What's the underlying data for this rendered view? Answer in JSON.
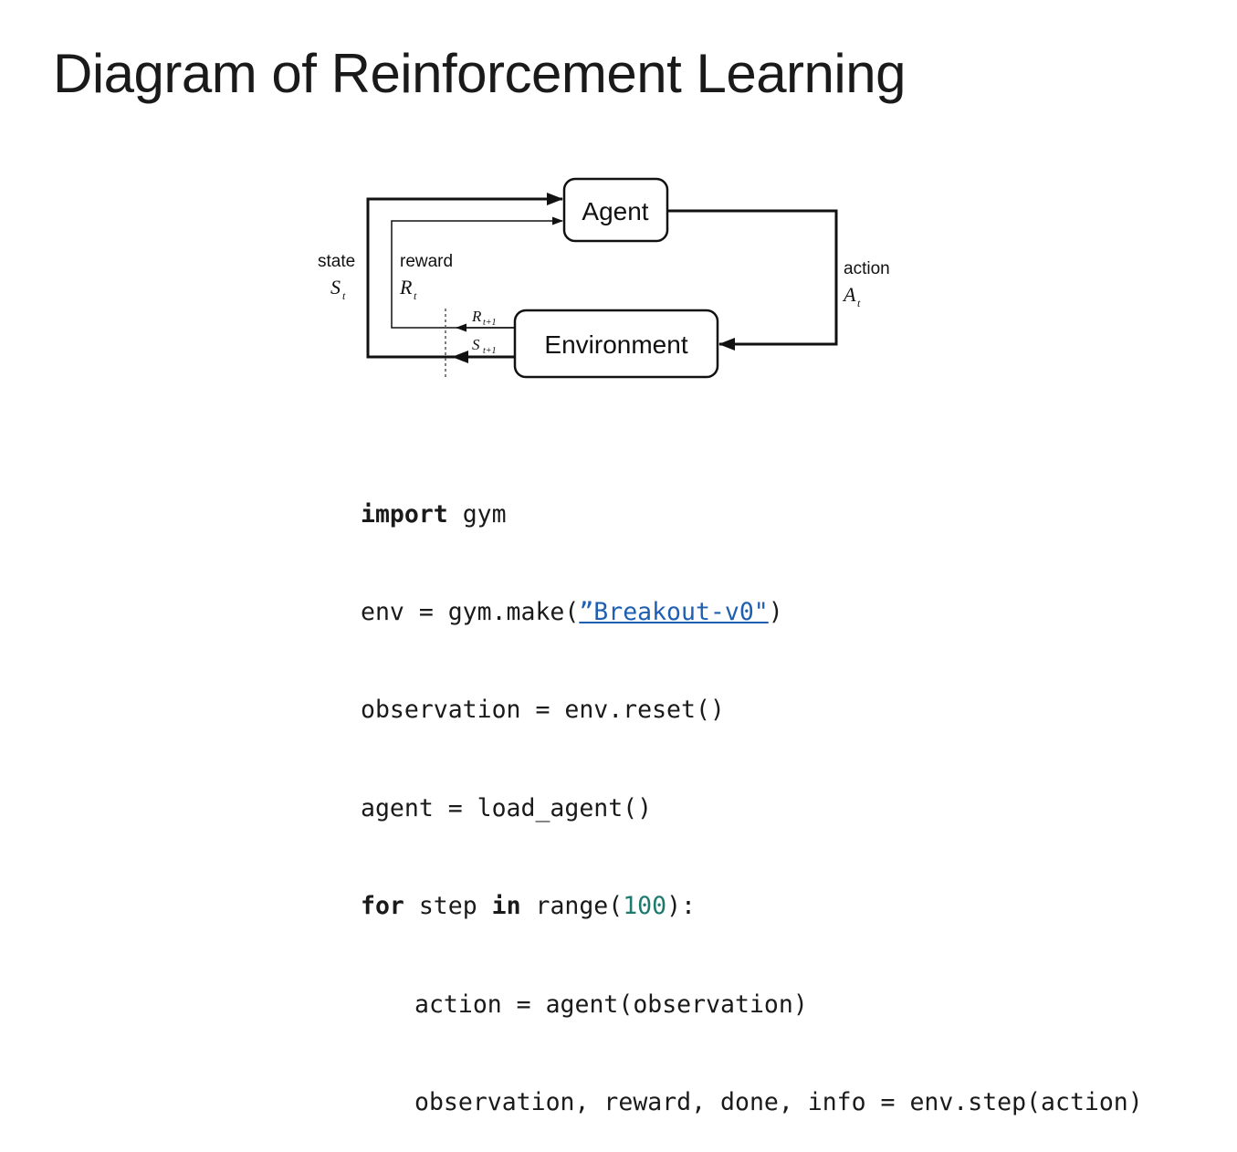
{
  "title": "Diagram of Reinforcement Learning",
  "diagram": {
    "agent_label": "Agent",
    "environment_label": "Environment",
    "state_label": "state",
    "state_symbol": "S",
    "state_symbol_sub": "t",
    "reward_label": "reward",
    "reward_symbol": "R",
    "reward_symbol_sub": "t",
    "action_label": "action",
    "action_symbol": "A",
    "action_symbol_sub": "t",
    "next_reward_symbol": "R",
    "next_reward_sub": "t+1",
    "next_state_symbol": "S",
    "next_state_sub": "t+1"
  },
  "code": {
    "line1_kw": "import",
    "line1_rest": " gym",
    "line2_pre": "env = gym.make(",
    "line2_str": "”Breakout-v0\"",
    "line2_post": ")",
    "line3": "observation = env.reset()",
    "line4": "agent = load_agent()",
    "line5_kw1": "for",
    "line5_mid": " step ",
    "line5_kw2": "in",
    "line5_pre_num": " range(",
    "line5_num": "100",
    "line5_post": "):",
    "line6": "action = agent(observation)",
    "line7": "observation, reward, done, info = env.step(action)"
  }
}
